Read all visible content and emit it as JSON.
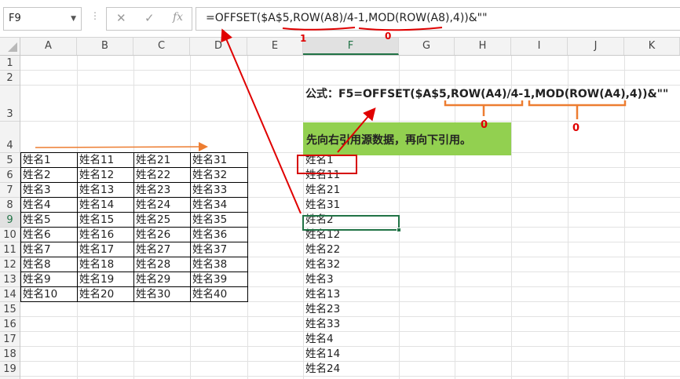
{
  "namebox": {
    "value": "F9"
  },
  "formula_bar": {
    "cancel_icon": "close-icon",
    "confirm_icon": "check-icon",
    "fx_label": "fx",
    "formula": "=OFFSET($A$5,ROW(A8)/4-1,MOD(ROW(A8),4))&\"\""
  },
  "annotations": {
    "top_num_1": "1",
    "top_num_0": "0",
    "formula_note": "公式：F5=OFFSET($A$5,ROW(A4)/4-1,MOD(ROW(A4),4))&\"\"",
    "note_num_a": "0",
    "note_num_b": "0",
    "green_text": "先向右引用源数据，再向下引用。",
    "colors": {
      "red": "#e00000",
      "orange": "#ed7d31",
      "green": "#92d050",
      "excel_green": "#217346"
    }
  },
  "columns": [
    "A",
    "B",
    "C",
    "D",
    "E",
    "F",
    "G",
    "H",
    "I",
    "J",
    "K"
  ],
  "rows": [
    "1",
    "2",
    "3",
    "4",
    "5",
    "6",
    "7",
    "8",
    "9",
    "10",
    "11",
    "12",
    "13",
    "14",
    "15",
    "16",
    "17",
    "18",
    "19"
  ],
  "table": [
    [
      "姓名1",
      "姓名11",
      "姓名21",
      "姓名31"
    ],
    [
      "姓名2",
      "姓名12",
      "姓名22",
      "姓名32"
    ],
    [
      "姓名3",
      "姓名13",
      "姓名23",
      "姓名33"
    ],
    [
      "姓名4",
      "姓名14",
      "姓名24",
      "姓名34"
    ],
    [
      "姓名5",
      "姓名15",
      "姓名25",
      "姓名35"
    ],
    [
      "姓名6",
      "姓名16",
      "姓名26",
      "姓名36"
    ],
    [
      "姓名7",
      "姓名17",
      "姓名27",
      "姓名37"
    ],
    [
      "姓名8",
      "姓名18",
      "姓名28",
      "姓名38"
    ],
    [
      "姓名9",
      "姓名19",
      "姓名29",
      "姓名39"
    ],
    [
      "姓名10",
      "姓名20",
      "姓名30",
      "姓名40"
    ]
  ],
  "f_column": [
    "姓名1",
    "姓名11",
    "姓名21",
    "姓名31",
    "姓名2",
    "姓名12",
    "姓名22",
    "姓名32",
    "姓名3",
    "姓名13",
    "姓名23",
    "姓名33",
    "姓名4",
    "姓名14",
    "姓名24"
  ]
}
